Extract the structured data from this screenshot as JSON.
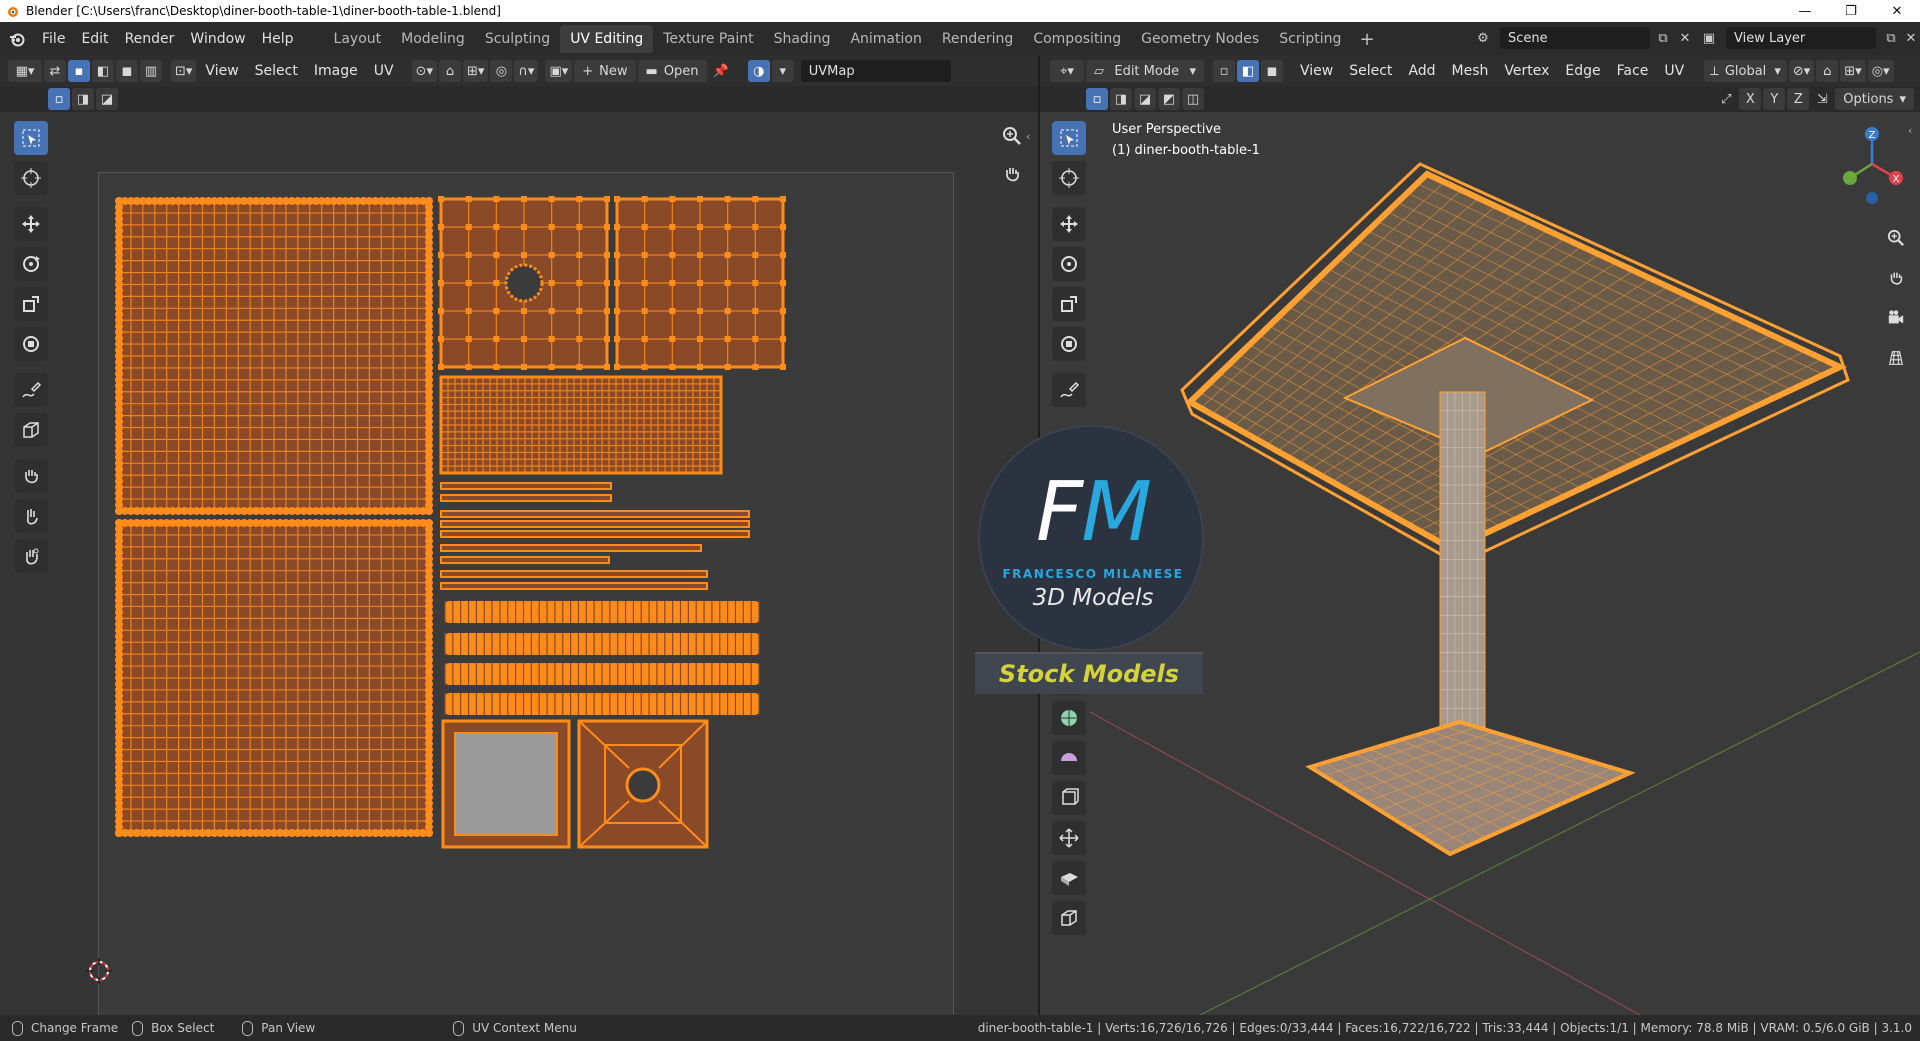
{
  "window": {
    "title": "Blender [C:\\Users\\franc\\Desktop\\diner-booth-table-1\\diner-booth-table-1.blend]",
    "controls": [
      "minimize",
      "maximize",
      "close"
    ]
  },
  "menu": {
    "items": [
      "File",
      "Edit",
      "Render",
      "Window",
      "Help"
    ]
  },
  "workspaces": {
    "tabs": [
      "Layout",
      "Modeling",
      "Sculpting",
      "UV Editing",
      "Texture Paint",
      "Shading",
      "Animation",
      "Rendering",
      "Compositing",
      "Geometry Nodes",
      "Scripting"
    ],
    "active": "UV Editing",
    "add_label": "+"
  },
  "scene": {
    "name": "Scene",
    "view_layer": "View Layer"
  },
  "uv_editor": {
    "menus": [
      "View",
      "Select",
      "Image",
      "UV"
    ],
    "new_label": "New",
    "open_label": "Open",
    "uvmap_name": "UVMap"
  },
  "viewport": {
    "mode": "Edit Mode",
    "menus": [
      "View",
      "Select",
      "Add",
      "Mesh",
      "Vertex",
      "Edge",
      "Face",
      "UV"
    ],
    "orientation": "Global",
    "options_label": "Options",
    "axes": [
      "X",
      "Y",
      "Z"
    ],
    "perspective_label": "User Perspective",
    "object_label": "(1) diner-booth-table-1"
  },
  "watermark": {
    "logo_letters": "FM",
    "author": "FRANCESCO MILANESE",
    "subtitle": "3D Models",
    "banner": "Stock Models"
  },
  "statusbar": {
    "hints": [
      "Change Frame",
      "Box Select",
      "Pan View",
      "UV Context Menu"
    ],
    "stats": "diner-booth-table-1 | Verts:16,726/16,726 | Edges:0/33,444 | Faces:16,722/16,722 | Tris:33,444 | Objects:1/1 | Memory: 78.8 MiB | VRAM: 0.5/6.0 GiB | 3.1.0"
  },
  "colors": {
    "accent": "#4772b3",
    "uv_orange": "#ff8c1a",
    "uv_face": "#8a4a28",
    "mesh_orange": "#ffa033",
    "watermark_blue": "#29a8e0",
    "banner_yellow": "#d6d23a"
  }
}
